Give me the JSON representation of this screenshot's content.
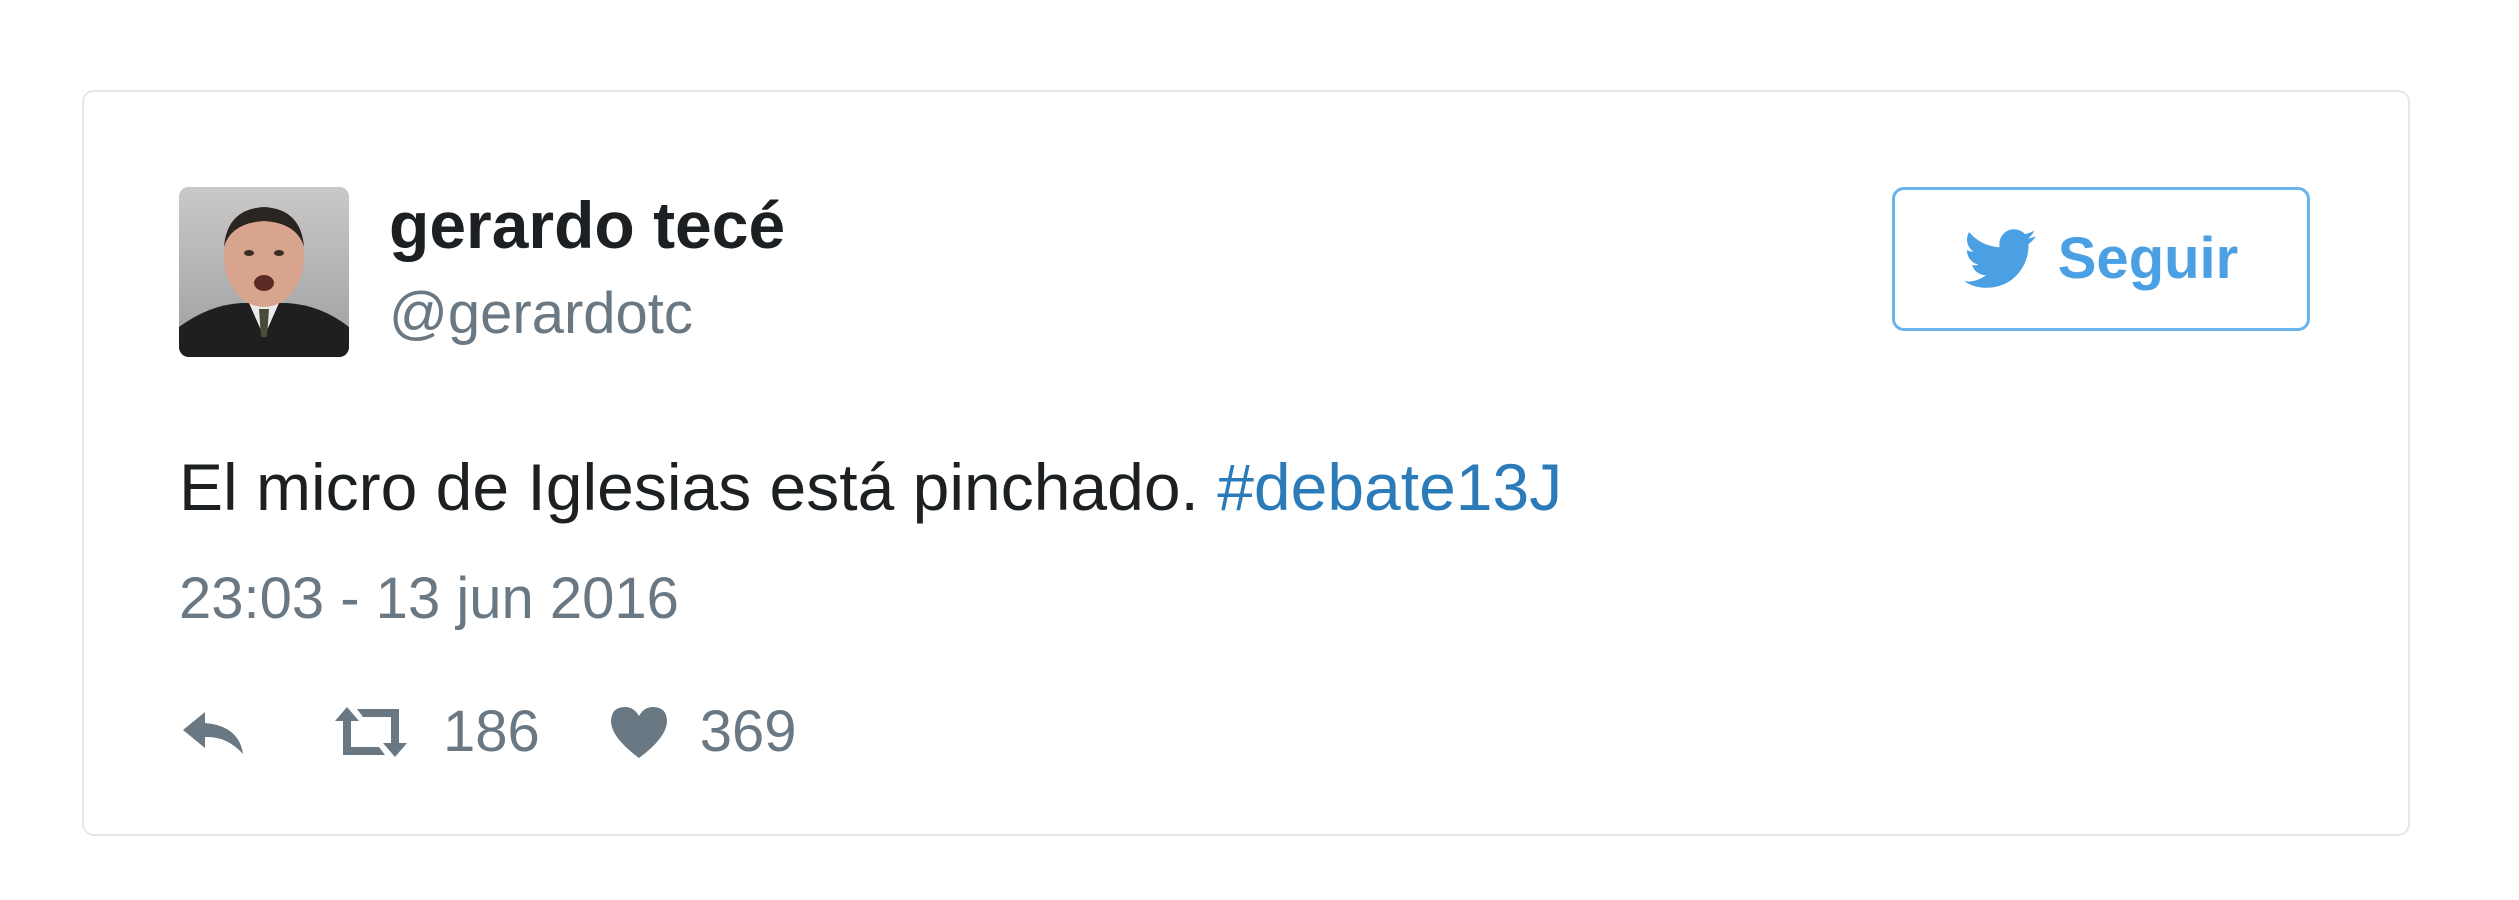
{
  "tweet": {
    "author": {
      "display_name": "gerardo tecé",
      "handle": "@gerardotc"
    },
    "follow_button": {
      "label": "Seguir",
      "icon": "twitter-bird-icon",
      "color": "#4aa0e3"
    },
    "text": {
      "body": "El micro de Iglesias está pinchado. ",
      "hashtag": "#debate13J",
      "hashtag_color": "#2b7bb9"
    },
    "timestamp": "23:03 - 13 jun 2016",
    "actions": {
      "reply_icon": "reply-icon",
      "retweet_icon": "retweet-icon",
      "retweet_count": "186",
      "like_icon": "heart-icon",
      "like_count": "369"
    }
  },
  "colors": {
    "text_primary": "#1c2022",
    "text_secondary": "#697882",
    "border": "#e1e8ed"
  }
}
